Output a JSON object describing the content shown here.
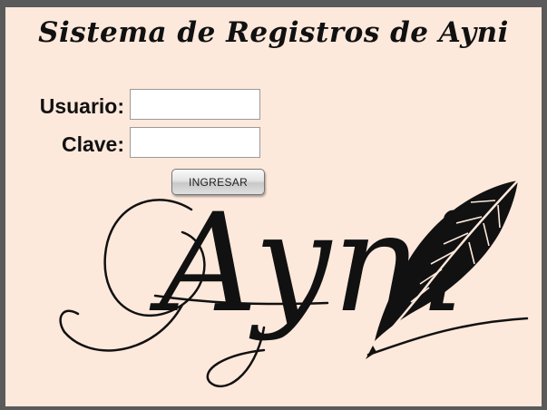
{
  "app": {
    "title": "Sistema de Registros de Ayni"
  },
  "login": {
    "user_label": "Usuario:",
    "user_value": "",
    "pass_label": "Clave:",
    "pass_value": "",
    "submit_label": "INGRESAR"
  },
  "logo": {
    "wordmark": "Ayni",
    "icon": "quill-pen-icon"
  },
  "colors": {
    "background": "#fde9dc",
    "ink": "#111111",
    "frame": "#5a5a5a"
  }
}
